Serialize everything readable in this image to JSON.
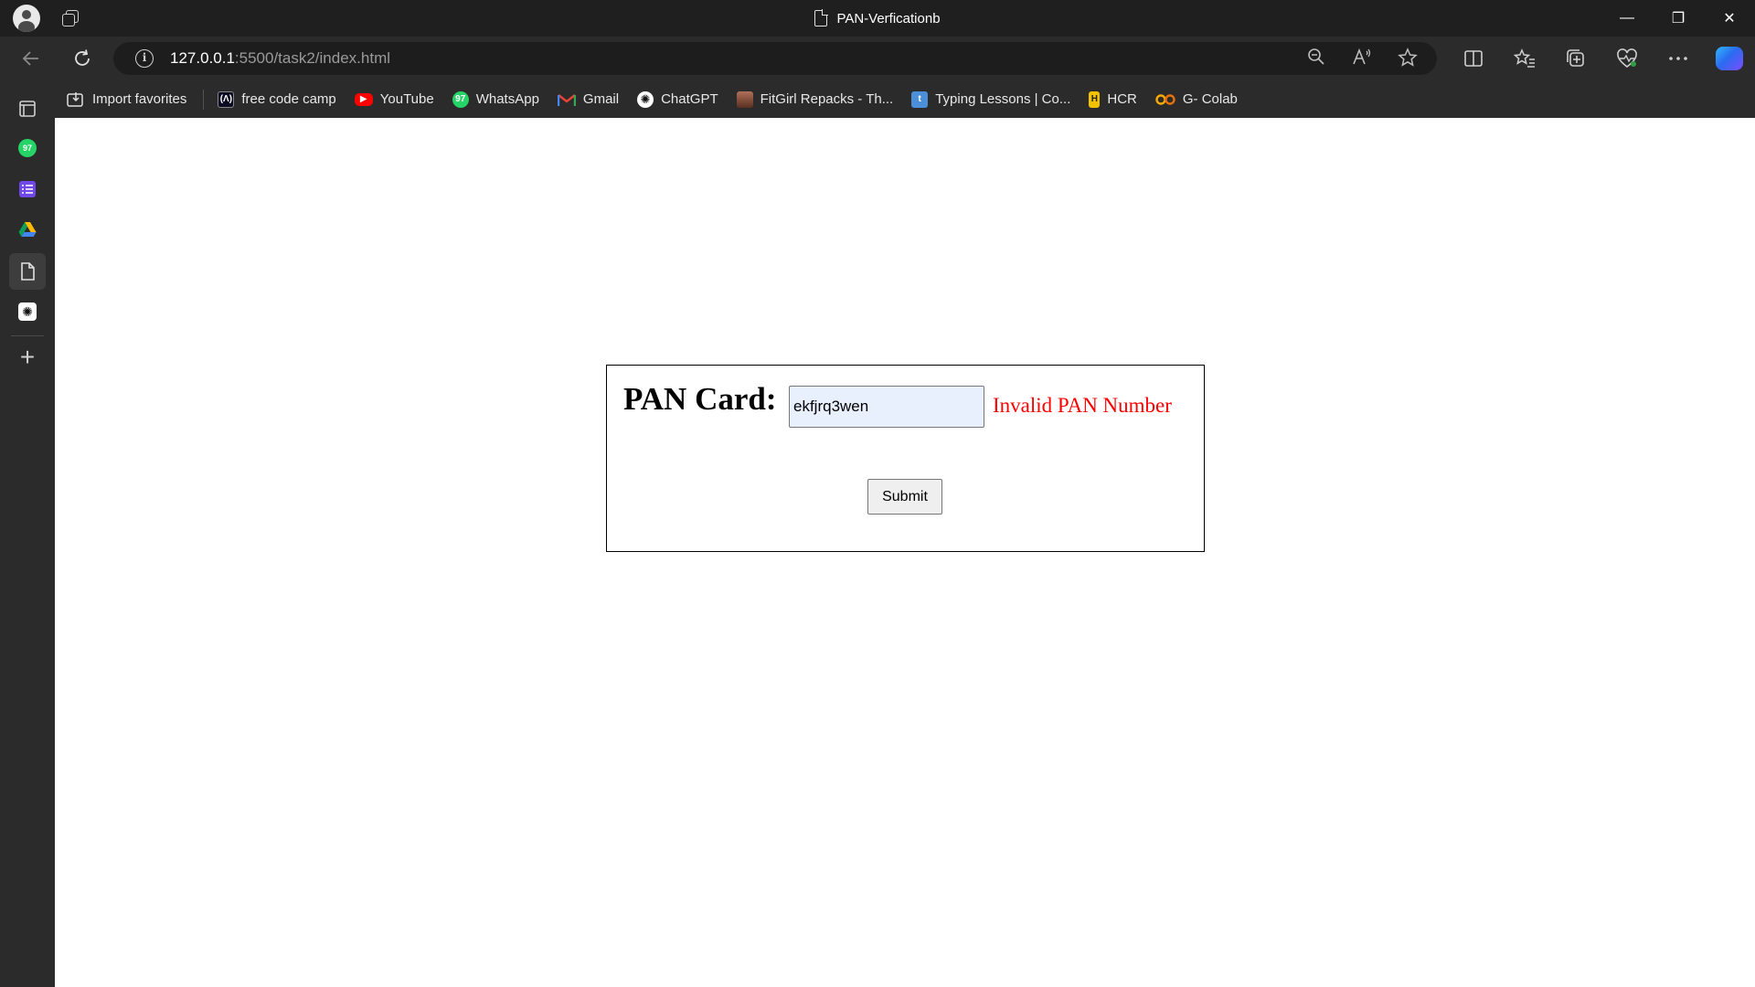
{
  "browser": {
    "tab_title": "PAN-Verficationb",
    "url_host": "127.0.0.1",
    "url_path": ":5500/task2/index.html",
    "window_controls": {
      "minimize": "—",
      "restore": "❐",
      "close": "✕"
    }
  },
  "favorites": [
    {
      "label": "Import favorites",
      "icon": "import-icon"
    },
    {
      "label": "free code camp",
      "icon": "freecodecamp-icon"
    },
    {
      "label": "YouTube",
      "icon": "youtube-icon"
    },
    {
      "label": "WhatsApp",
      "icon": "whatsapp-icon"
    },
    {
      "label": "Gmail",
      "icon": "gmail-icon"
    },
    {
      "label": "ChatGPT",
      "icon": "chatgpt-icon"
    },
    {
      "label": "FitGirl Repacks - Th...",
      "icon": "fitgirl-icon"
    },
    {
      "label": "Typing Lessons | Co...",
      "icon": "typing-icon"
    },
    {
      "label": "HCR",
      "icon": "hcr-icon"
    },
    {
      "label": "G- Colab",
      "icon": "colab-icon"
    }
  ],
  "sidebar": {
    "items": [
      {
        "name": "tabs-icon"
      },
      {
        "name": "whatsapp-icon",
        "badge": "97"
      },
      {
        "name": "list-icon"
      },
      {
        "name": "google-drive-icon"
      },
      {
        "name": "document-icon",
        "selected": true
      },
      {
        "name": "chatgpt-icon"
      }
    ],
    "add_label": "+"
  },
  "form": {
    "label": "PAN Card:",
    "input_value": "ekfjrq3wen",
    "error_message": "Invalid PAN Number",
    "submit_label": "Submit"
  },
  "colors": {
    "error": "#ff0000",
    "input_autofill_bg": "#e8f0fe",
    "chrome_bg": "#2b2b2b"
  }
}
